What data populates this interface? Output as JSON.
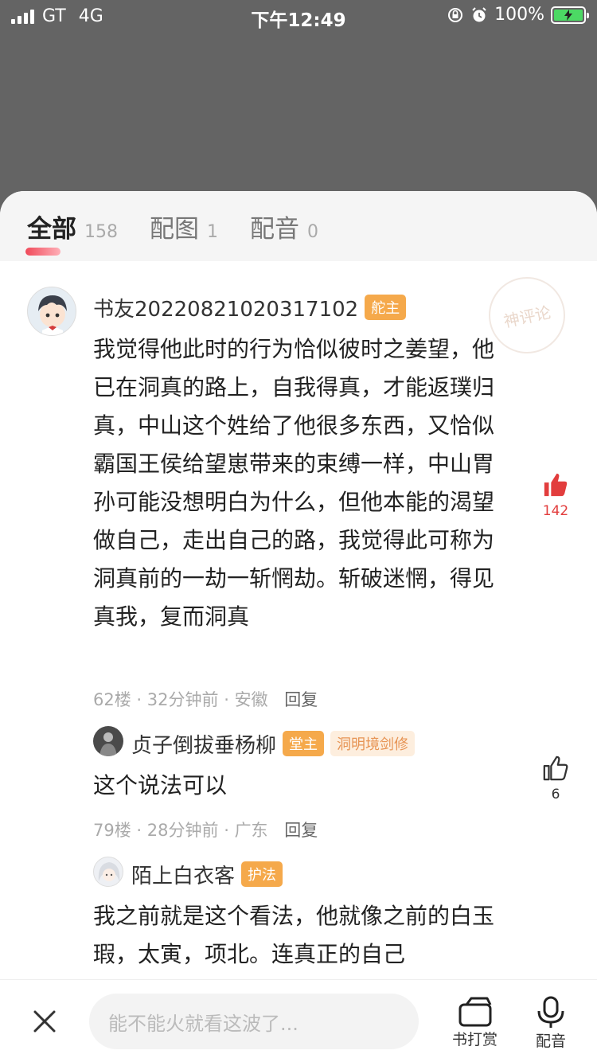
{
  "status_bar": {
    "carrier": "GT",
    "network": "4G",
    "time": "下午12:49",
    "battery": "100%",
    "battery_level": 1.0
  },
  "tabs": [
    {
      "label": "全部",
      "count": "158",
      "active": true
    },
    {
      "label": "配图",
      "count": "1",
      "active": false
    },
    {
      "label": "配音",
      "count": "0",
      "active": false
    }
  ],
  "watermark": "神评论",
  "main_comment": {
    "username": "书友20220821020317102",
    "badge": "舵主",
    "text": "我觉得他此时的行为恰似彼时之姜望，他已在洞真的路上，自我得真，才能返璞归真，中山这个姓给了他很多东西，又恰似霸国王侯给望崽带来的束缚一样，中山胃孙可能没想明白为什么，但他本能的渴望做自己，走出自己的路，我觉得此可称为洞真前的一劫一斩惘劫。斩破迷惘，得见真我，复而洞真",
    "floor": "62楼",
    "time": "32分钟前",
    "location": "安徽",
    "reply_label": "回复",
    "likes": "142",
    "liked": true
  },
  "reply_1": {
    "username": "贞子倒拔垂杨柳",
    "badge": "堂主",
    "badge2": "洞明境剑修",
    "text": "这个说法可以",
    "floor": "79楼",
    "time": "28分钟前",
    "location": "广东",
    "reply_label": "回复",
    "likes": "6",
    "liked": false
  },
  "reply_2": {
    "username": "陌上白衣客",
    "badge": "护法",
    "text": "我之前就是这个看法，他就像之前的白玉瑕，太寅，项北。连真正的自己"
  },
  "bottom_bar": {
    "input_placeholder": "能不能火就看这波了...",
    "reward_label": "书打赏",
    "voice_label": "配音"
  },
  "colors": {
    "accent_red": "#e23d3d",
    "badge_orange": "#f5a94b",
    "overlay": "#646464"
  }
}
